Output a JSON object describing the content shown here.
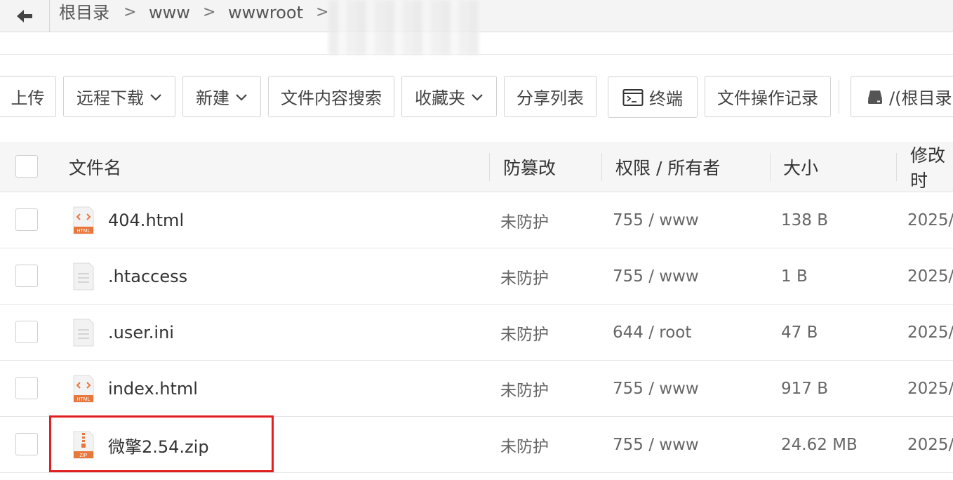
{
  "breadcrumb": {
    "items": [
      "根目录",
      "www",
      "wwwroot"
    ],
    "separator": ">"
  },
  "toolbar": {
    "upload": "上传",
    "remote_download": "远程下载",
    "new": "新建",
    "content_search": "文件内容搜索",
    "favorites": "收藏夹",
    "share_list": "分享列表",
    "terminal": "终端",
    "op_log": "文件操作记录",
    "disk": "/(根目录"
  },
  "table": {
    "headers": {
      "name": "文件名",
      "tamper": "防篡改",
      "perm": "权限 / 所有者",
      "size": "大小",
      "modified": "修改时"
    },
    "rows": [
      {
        "icon": "html-file-icon",
        "name": "404.html",
        "tamper": "未防护",
        "perm": "755 / www",
        "size": "138 B",
        "modified": "2025/"
      },
      {
        "icon": "text-file-icon",
        "name": ".htaccess",
        "tamper": "未防护",
        "perm": "755 / www",
        "size": "1 B",
        "modified": "2025/"
      },
      {
        "icon": "text-file-icon",
        "name": ".user.ini",
        "tamper": "未防护",
        "perm": "644 / root",
        "size": "47 B",
        "modified": "2025/"
      },
      {
        "icon": "html-file-icon",
        "name": "index.html",
        "tamper": "未防护",
        "perm": "755 / www",
        "size": "917 B",
        "modified": "2025/"
      },
      {
        "icon": "zip-file-icon",
        "name": "微擎2.54.zip",
        "tamper": "未防护",
        "perm": "755 / www",
        "size": "24.62 MB",
        "modified": "2025/"
      }
    ],
    "highlighted_row": 4
  },
  "icon_labels": {
    "html": "HTML",
    "zip": "ZIP"
  },
  "colors": {
    "highlight": "#e02020",
    "html_icon": "#e8773c"
  }
}
